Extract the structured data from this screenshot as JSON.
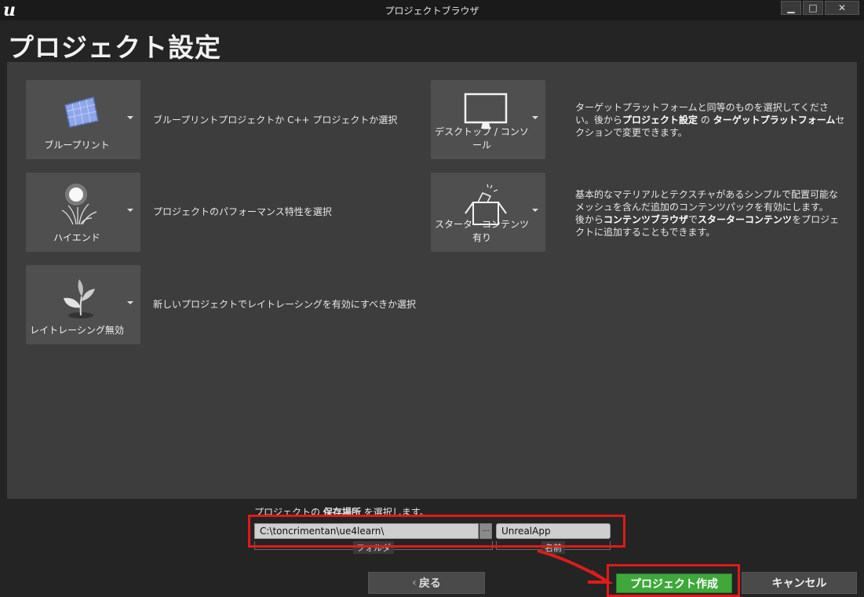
{
  "window": {
    "title": "プロジェクトブラウザ",
    "logo_text": "u"
  },
  "page": {
    "title": "プロジェクト設定"
  },
  "options": [
    {
      "id": "blueprint",
      "label": "ブループリント",
      "icon": "blueprint-icon",
      "description": "ブループリントプロジェクトか C++ プロジェクトか選択"
    },
    {
      "id": "quality",
      "label": "ハイエンド",
      "icon": "high-end-icon",
      "description": "プロジェクトのパフォーマンス特性を選択"
    },
    {
      "id": "raytracing",
      "label": "レイトレーシング無効",
      "icon": "plant-icon",
      "description": "新しいプロジェクトでレイトレーシングを有効にすべきか選択"
    },
    {
      "id": "platform",
      "label": "デスクトップ / コンソール",
      "icon": "monitor-icon",
      "description_parts": [
        "ターゲットプラットフォームと同等のものを選択してください。後から",
        "プロジェクト設定",
        "の",
        "ターゲットプラットフォーム",
        "セクションで変更できます。"
      ]
    },
    {
      "id": "starter",
      "label": "スターターコンテンツ有り",
      "icon": "starter-box-icon",
      "description_parts": [
        "基本的なマテリアルとテクスチャがあるシンプルで配置可能なメッシュを含んだ追加のコンテンツパックを有効にします。",
        "後から",
        "コンテンツブラウザ",
        "で",
        "スターターコンテンツ",
        "をプロジェクトに追加することもできます。"
      ]
    }
  ],
  "location": {
    "label_prefix": "プロジェクトの",
    "label_bold": "保存場所",
    "label_suffix": "を選択します。",
    "folder_path": "C:\\toncrimentan\\ue4learn\\",
    "browse_label": "···",
    "folder_caption": "フォルダ",
    "project_name": "UnrealApp",
    "name_caption": "名前"
  },
  "buttons": {
    "back": "戻る",
    "back_chevron": "‹",
    "create": "プロジェクト作成",
    "cancel": "キャンセル"
  },
  "window_controls": {
    "minimize": "▁",
    "maximize": "□",
    "close": "✕"
  },
  "colors": {
    "accent_green": "#3ea83a",
    "highlight_red": "#e01a1a"
  }
}
